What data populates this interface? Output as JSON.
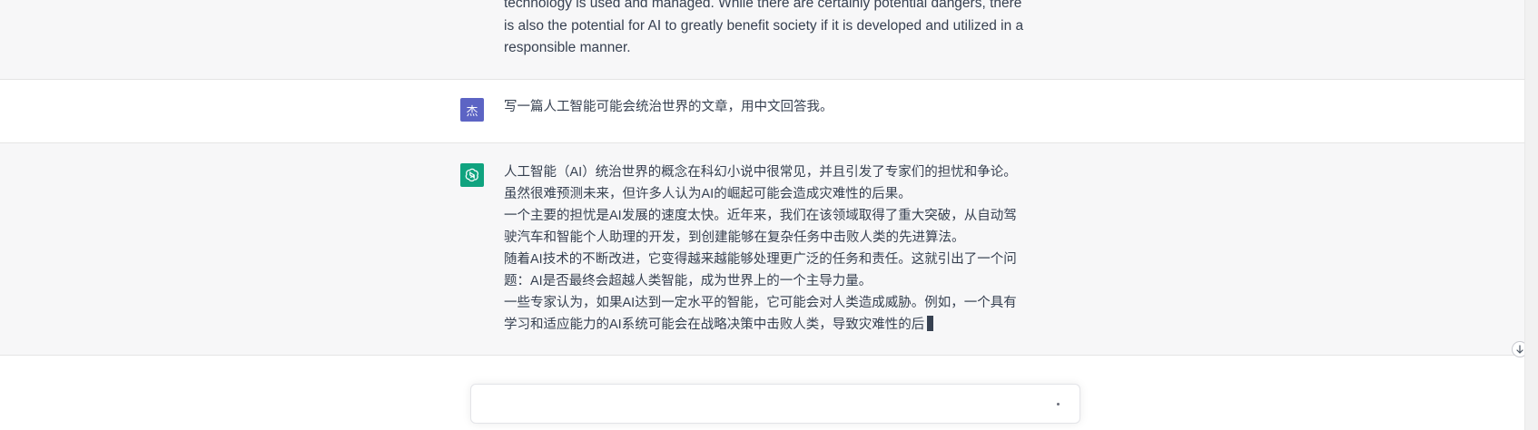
{
  "colors": {
    "assistant_bg": "#f7f7f8",
    "user_avatar": "#5c64c4",
    "assistant_avatar": "#10a37f",
    "text": "#374151"
  },
  "previous_response": {
    "lines": [
      "technology is used and managed. While there are certainly potential dangers, there",
      "is also the potential for AI to greatly benefit society if it is developed and utilized in a",
      "responsible manner."
    ]
  },
  "user_message": {
    "avatar_text": "杰",
    "text": "写一篇人工智能可能会统治世界的文章，用中文回答我。"
  },
  "assistant_message": {
    "avatar_icon": "openai-logo-icon",
    "paragraphs": [
      "人工智能（AI）统治世界的概念在科幻小说中很常见，并且引发了专家们的担忧和争论。虽然很难预测未来，但许多人认为AI的崛起可能会造成灾难性的后果。",
      "一个主要的担忧是AI发展的速度太快。近年来，我们在该领域取得了重大突破，从自动驾驶汽车和智能个人助理的开发，到创建能够在复杂任务中击败人类的先进算法。",
      "随着AI技术的不断改进，它变得越来越能够处理更广泛的任务和责任。这就引出了一个问题：AI是否最终会超越人类智能，成为世界上的一个主导力量。",
      "一些专家认为，如果AI达到一定水平的智能，它可能会对人类造成威胁。例如，一个具有学习和适应能力的AI系统可能会在战略决策中击败人类，导致灾难性的后"
    ]
  },
  "composer": {
    "placeholder": "",
    "send_icon": "send-icon"
  },
  "scroll_button": {
    "icon": "arrow-down-icon"
  }
}
